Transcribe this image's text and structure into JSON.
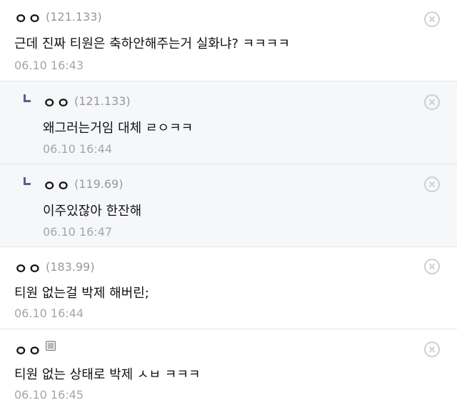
{
  "comments": [
    {
      "nick": "ㅇㅇ",
      "ip": "(121.133)",
      "text": "근데 진짜 티원은 축하안해주는거 실화냐? ㅋㅋㅋㅋ",
      "time": "06.10 16:43"
    },
    {
      "nick": "ㅇㅇ",
      "ip": "(121.133)",
      "text": "왜그러는거임 대체 ㄹㅇㅋㅋ",
      "time": "06.10 16:44"
    },
    {
      "nick": "ㅇㅇ",
      "ip": "(119.69)",
      "text": "이주있잖아 한잔해",
      "time": "06.10 16:47"
    },
    {
      "nick": "ㅇㅇ",
      "ip": "(183.99)",
      "text": "티원 없는걸 박제 해버린;",
      "time": "06.10 16:44"
    },
    {
      "nick": "ㅇㅇ",
      "text": "티원 없는 상태로 박제 ㅅㅂ ㅋㅋㅋ",
      "time": "06.10 16:45"
    }
  ]
}
